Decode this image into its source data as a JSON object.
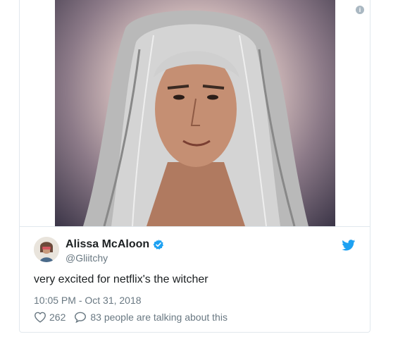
{
  "tweet": {
    "author_name": "Alissa McAloon",
    "handle": "@Gliitchy",
    "text": "very excited for netflix's the witcher",
    "timestamp": "10:05 PM - Oct 31, 2018",
    "like_count": "262",
    "conversation_text": "83 people are talking about this",
    "verified": true
  },
  "media": {
    "icon": "info-icon",
    "info_glyph": "i"
  },
  "colors": {
    "twitter_blue": "#1da1f2",
    "border": "#e1e8ed",
    "text": "#1c2022",
    "muted": "#697882"
  }
}
